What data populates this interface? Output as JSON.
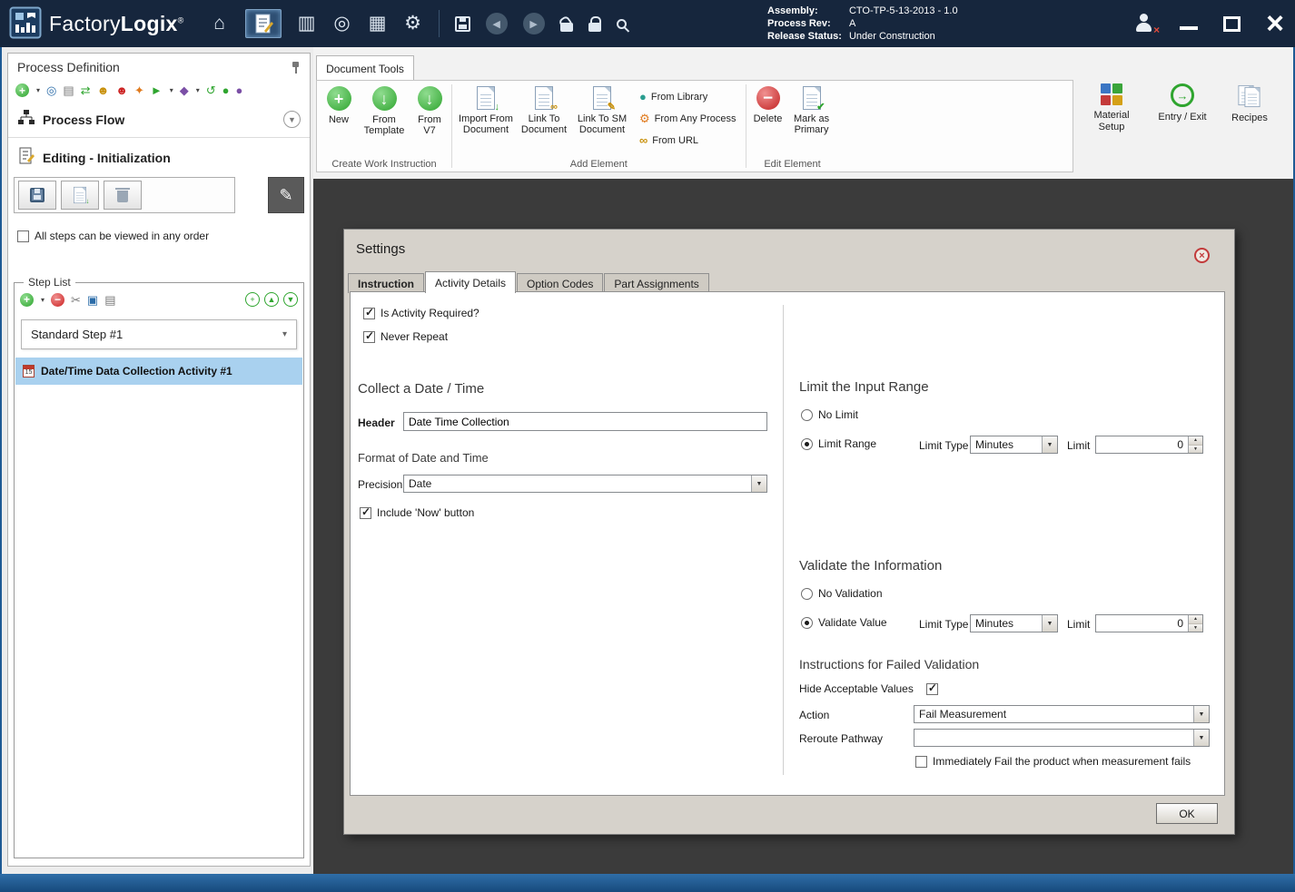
{
  "titlebar": {
    "app_name_a": "Factory",
    "app_name_b": "Logix",
    "registered": "®",
    "assembly_label": "Assembly:",
    "assembly_value": "CTO-TP-5-13-2013 - 1.0",
    "process_rev_label": "Process Rev:",
    "process_rev_value": "A",
    "release_status_label": "Release Status:",
    "release_status_value": "Under Construction"
  },
  "sidebar": {
    "title": "Process Definition",
    "process_flow_label": "Process Flow",
    "editing_label": "Editing - Initialization",
    "any_order_label": "All steps can be viewed in any order",
    "step_list_title": "Step List",
    "step_name": "Standard Step #1",
    "activity_name": "Date/Time Data Collection Activity #1"
  },
  "ribbon": {
    "tab_label": "Document Tools",
    "create_group_label": "Create Work Instruction",
    "new_label": "New",
    "from_template_label": "From Template",
    "from_v7_label": "From V7",
    "add_group_label": "Add Element",
    "import_from_document_label": "Import From Document",
    "link_to_document_label": "Link To Document",
    "link_to_sm_document_label": "Link To SM Document",
    "from_library_label": "From Library",
    "from_any_process_label": "From Any Process",
    "from_url_label": "From URL",
    "edit_group_label": "Edit Element",
    "delete_label": "Delete",
    "mark_as_primary_label": "Mark as Primary",
    "material_setup_label": "Material Setup",
    "entry_exit_label": "Entry / Exit",
    "recipes_label": "Recipes"
  },
  "dialog": {
    "title": "Settings",
    "tabs": [
      {
        "label": "Instruction"
      },
      {
        "label": "Activity Details"
      },
      {
        "label": "Option Codes"
      },
      {
        "label": "Part Assignments"
      }
    ],
    "is_activity_required_label": "Is Activity Required?",
    "never_repeat_label": "Never Repeat",
    "collect_title": "Collect a Date / Time",
    "header_label": "Header",
    "header_value": "Date Time Collection",
    "format_title": "Format of Date and Time",
    "precision_label": "Precision",
    "precision_value": "Date",
    "include_now_label": "Include 'Now' button",
    "limit_title": "Limit the Input Range",
    "no_limit_label": "No Limit",
    "limit_range_label": "Limit Range",
    "limit_type_label": "Limit Type",
    "limit_type_value": "Minutes",
    "limit_label": "Limit",
    "limit_value": "0",
    "validate_title": "Validate the Information",
    "no_validation_label": "No Validation",
    "validate_value_label": "Validate Value",
    "validate_limit_type_value": "Minutes",
    "validate_limit_value": "0",
    "failed_title": "Instructions for Failed Validation",
    "hide_acceptable_label": "Hide Acceptable Values",
    "action_label": "Action",
    "action_value": "Fail Measurement",
    "reroute_label": "Reroute Pathway",
    "reroute_value": "",
    "immediately_fail_label": "Immediately Fail the product when measurement fails",
    "ok_label": "OK"
  },
  "icons": {
    "home": "⌂",
    "documents": "▥",
    "navigate": "◎",
    "windows": "▦",
    "gear": "⚙",
    "back": "◀",
    "forward": "▶",
    "close": "×",
    "plus": "+",
    "minus": "−",
    "caret_down": "▾",
    "scissors": "✂",
    "copy": "▣",
    "paste": "▤",
    "printer": "▤",
    "sync": "⇄",
    "user": "☻",
    "star": "✦",
    "play": "►",
    "diamond": "◆",
    "undo": "↺",
    "dot": "●",
    "arrow_up": "▲",
    "arrow_down": "▼",
    "down_arrow": "↓",
    "right_arrow": "→",
    "check": "✔",
    "pencil": "✎",
    "chain": "∞",
    "select_arrow": "▼",
    "spin_up": "▲",
    "spin_down": "▼",
    "calendar_day": "15"
  },
  "colors": {
    "titlebar_bg": "#16263d",
    "selection_blue": "#a9d1ef",
    "content_dark": "#3b3b3b",
    "dialog_gray": "#d6d2cb",
    "green": "#2fa52f",
    "red": "#cc2222"
  }
}
